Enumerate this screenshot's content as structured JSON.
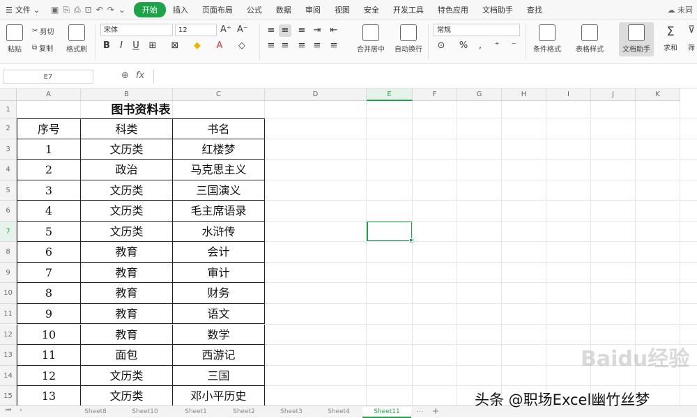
{
  "menubar": {
    "file_label": "文件",
    "tabs": [
      "开始",
      "插入",
      "页面布局",
      "公式",
      "数据",
      "审阅",
      "视图",
      "安全",
      "开发工具",
      "特色应用",
      "文档助手",
      "查找"
    ],
    "active_tab": "开始",
    "right_label": "未同"
  },
  "ribbon": {
    "paste_label": "粘贴",
    "cut_label": "剪切",
    "copy_label": "复制",
    "format_painter_label": "格式刷",
    "font_name": "宋体",
    "font_size": "12",
    "number_format": "常规",
    "merge_label": "合并居中",
    "wrap_label": "自动换行",
    "cond_format_label": "条件格式",
    "table_style_label": "表格样式",
    "doc_helper_label": "文档助手",
    "sum_label": "求和",
    "filter_label": "筛"
  },
  "formula_bar": {
    "cell_ref": "E7",
    "fx_label": "fx",
    "content": ""
  },
  "grid": {
    "columns": [
      "A",
      "B",
      "C",
      "D",
      "E",
      "F",
      "G",
      "H",
      "I",
      "J",
      "K"
    ],
    "rows": [
      "1",
      "2",
      "3",
      "4",
      "5",
      "6",
      "7",
      "8",
      "9",
      "10",
      "11",
      "12",
      "13",
      "14",
      "15"
    ],
    "selected_column": "E",
    "selected_row": "7",
    "accent_color": "#1fa34a"
  },
  "table": {
    "title": "图书资料表",
    "headers": [
      "序号",
      "科类",
      "书名"
    ],
    "rows": [
      [
        "1",
        "文历类",
        "红楼梦"
      ],
      [
        "2",
        "政治",
        "马克思主义"
      ],
      [
        "3",
        "文历类",
        "三国演义"
      ],
      [
        "4",
        "文历类",
        "毛主席语录"
      ],
      [
        "5",
        "文历类",
        "水浒传"
      ],
      [
        "6",
        "教育",
        "会计"
      ],
      [
        "7",
        "教育",
        "审计"
      ],
      [
        "8",
        "教育",
        "财务"
      ],
      [
        "9",
        "教育",
        "语文"
      ],
      [
        "10",
        "教育",
        "数学"
      ],
      [
        "11",
        "面包",
        "西游记"
      ],
      [
        "12",
        "文历类",
        "三国"
      ],
      [
        "13",
        "文历类",
        "邓小平历史"
      ]
    ]
  },
  "sheets": {
    "tabs": [
      "Sheet8",
      "Sheet10",
      "Sheet1",
      "Sheet2",
      "Sheet3",
      "Sheet4",
      "Sheet11"
    ],
    "active": "Sheet11"
  },
  "overlay": {
    "watermark": "Baidu经验",
    "credit": "头条 @职场Excel幽竹丝梦"
  }
}
